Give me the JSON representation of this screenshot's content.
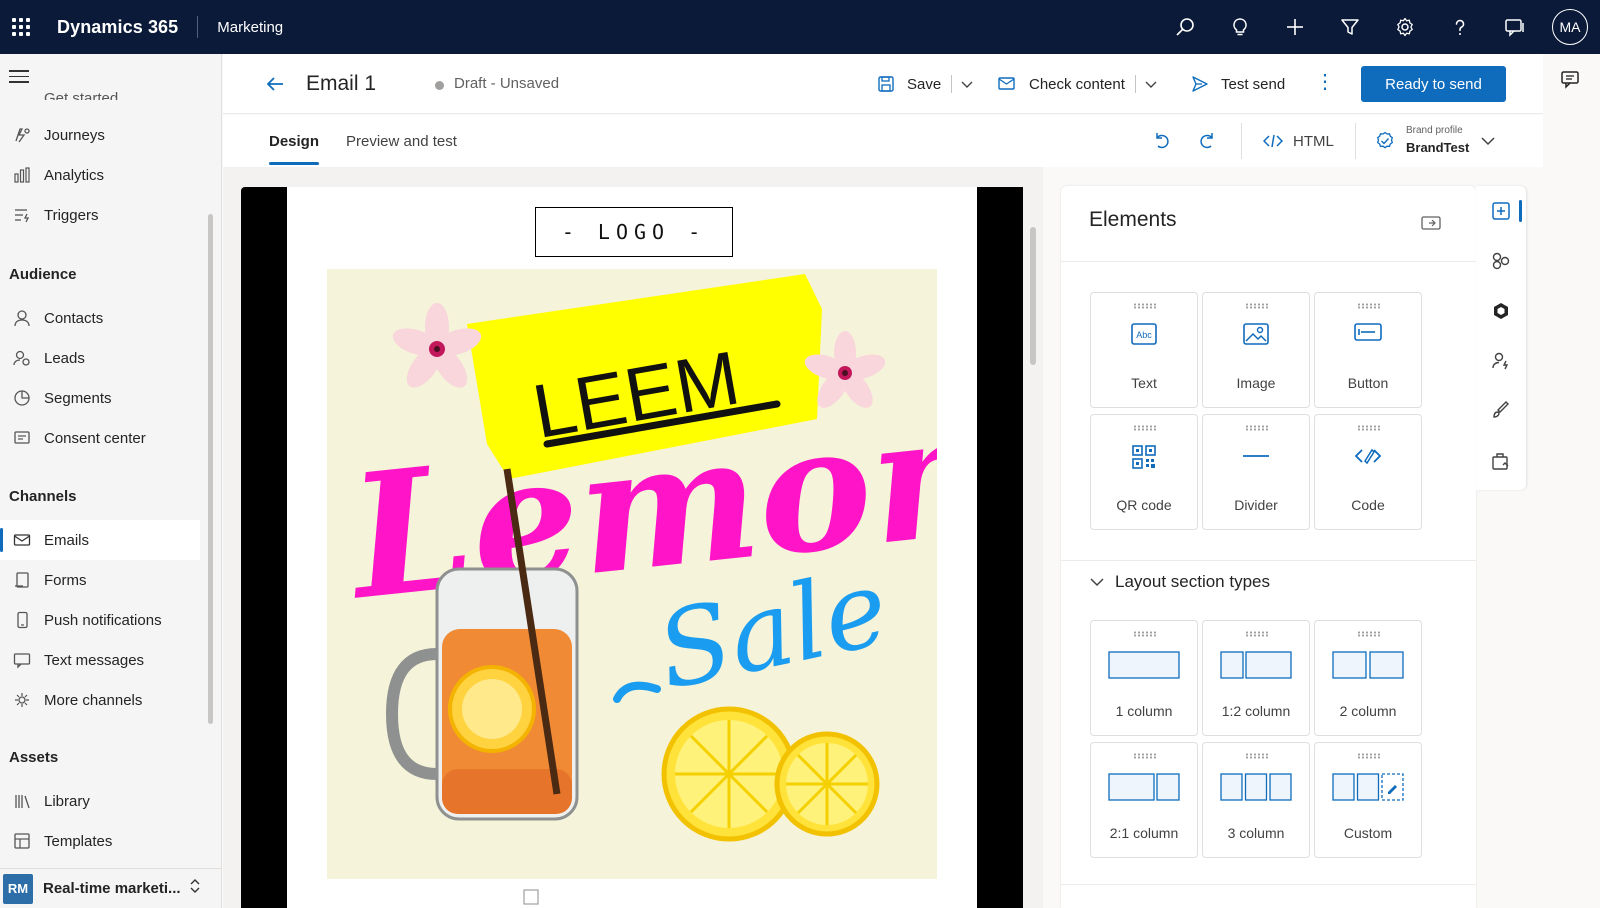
{
  "topbar": {
    "app_name": "Dynamics 365",
    "module": "Marketing",
    "icons": [
      "search-icon",
      "lightbulb-icon",
      "add-icon",
      "filter-icon",
      "settings-icon",
      "help-icon",
      "chat-icon"
    ],
    "user_initials": "MA"
  },
  "sidenav": {
    "cut_item": "Get started",
    "groups": [
      {
        "header": "",
        "items": [
          {
            "label": "Journeys",
            "icon": "journeys-icon"
          },
          {
            "label": "Analytics",
            "icon": "analytics-icon"
          },
          {
            "label": "Triggers",
            "icon": "triggers-icon"
          }
        ]
      },
      {
        "header": "Audience",
        "items": [
          {
            "label": "Contacts",
            "icon": "contact-icon"
          },
          {
            "label": "Leads",
            "icon": "leads-icon"
          },
          {
            "label": "Segments",
            "icon": "segments-icon"
          },
          {
            "label": "Consent center",
            "icon": "consent-icon"
          }
        ]
      },
      {
        "header": "Channels",
        "items": [
          {
            "label": "Emails",
            "icon": "mail-icon",
            "active": true
          },
          {
            "label": "Forms",
            "icon": "form-icon"
          },
          {
            "label": "Push notifications",
            "icon": "phone-icon"
          },
          {
            "label": "Text messages",
            "icon": "message-icon"
          },
          {
            "label": "More channels",
            "icon": "more-channels-icon"
          }
        ]
      },
      {
        "header": "Assets",
        "items": [
          {
            "label": "Library",
            "icon": "library-icon"
          },
          {
            "label": "Templates",
            "icon": "templates-icon"
          }
        ]
      }
    ],
    "area": {
      "badge": "RM",
      "name": "Real-time marketi..."
    }
  },
  "command_bar": {
    "title": "Email 1",
    "status": "Draft - Unsaved",
    "save_label": "Save",
    "check_label": "Check content",
    "test_label": "Test send",
    "primary_label": "Ready to send"
  },
  "tabs": {
    "design": "Design",
    "preview": "Preview and test",
    "html_label": "HTML",
    "brand_profile_label": "Brand profile",
    "brand_profile_value": "BrandTest"
  },
  "email": {
    "logo_text": "- LOGO -",
    "hero_tag": "LEEM",
    "hero_title": "Lemom",
    "hero_subtitle": "Sale"
  },
  "panel": {
    "title": "Elements",
    "elements": [
      {
        "label": "Text",
        "icon": "text-icon"
      },
      {
        "label": "Image",
        "icon": "image-icon"
      },
      {
        "label": "Button",
        "icon": "button-icon"
      },
      {
        "label": "QR code",
        "icon": "qr-code-icon"
      },
      {
        "label": "Divider",
        "icon": "divider-icon"
      },
      {
        "label": "Code",
        "icon": "code-icon"
      }
    ],
    "layout_header": "Layout section types",
    "layouts": [
      {
        "label": "1 column"
      },
      {
        "label": "1:2 column"
      },
      {
        "label": "2 column"
      },
      {
        "label": "2:1 column"
      },
      {
        "label": "3 column"
      },
      {
        "label": "Custom"
      }
    ]
  },
  "rail": [
    "add-elements-icon",
    "styles-icon",
    "copilot-icon",
    "personalization-icon",
    "brush-icon",
    "assets-icon"
  ],
  "colors": {
    "accent": "#0f6cbd",
    "topbar": "#0b1a38",
    "hero_pink": "#ff14c8",
    "hero_blue": "#1a9cf0",
    "hero_yellow": "#ffff00"
  }
}
